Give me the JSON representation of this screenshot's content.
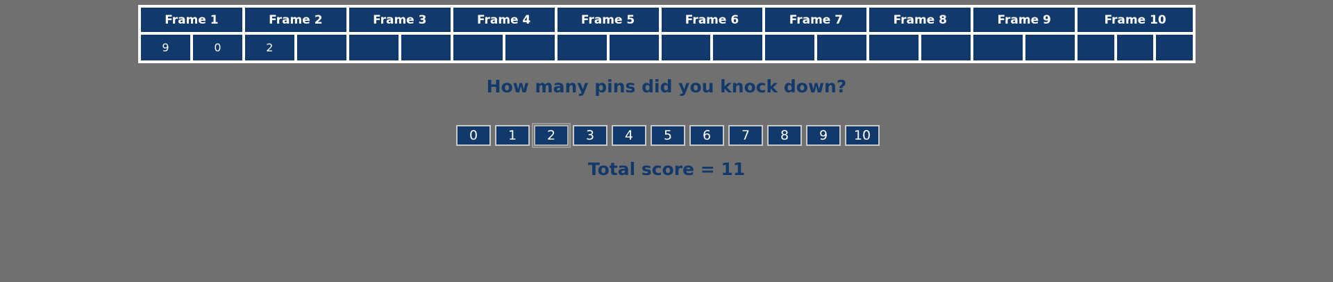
{
  "frames": [
    {
      "label": "Frame 1",
      "rolls": [
        "9",
        "0"
      ]
    },
    {
      "label": "Frame 2",
      "rolls": [
        "2",
        ""
      ]
    },
    {
      "label": "Frame 3",
      "rolls": [
        "",
        ""
      ]
    },
    {
      "label": "Frame 4",
      "rolls": [
        "",
        ""
      ]
    },
    {
      "label": "Frame 5",
      "rolls": [
        "",
        ""
      ]
    },
    {
      "label": "Frame 6",
      "rolls": [
        "",
        ""
      ]
    },
    {
      "label": "Frame 7",
      "rolls": [
        "",
        ""
      ]
    },
    {
      "label": "Frame 8",
      "rolls": [
        "",
        ""
      ]
    },
    {
      "label": "Frame 9",
      "rolls": [
        "",
        ""
      ]
    },
    {
      "label": "Frame 10",
      "rolls": [
        "",
        "",
        ""
      ]
    }
  ],
  "prompt": "How many pins did you knock down?",
  "pin_buttons": [
    "0",
    "1",
    "2",
    "3",
    "4",
    "5",
    "6",
    "7",
    "8",
    "9",
    "10"
  ],
  "total_score": "Total score = 11",
  "colors": {
    "background": "#707070",
    "cell": "#12396b",
    "accent_text": "#12396b"
  }
}
